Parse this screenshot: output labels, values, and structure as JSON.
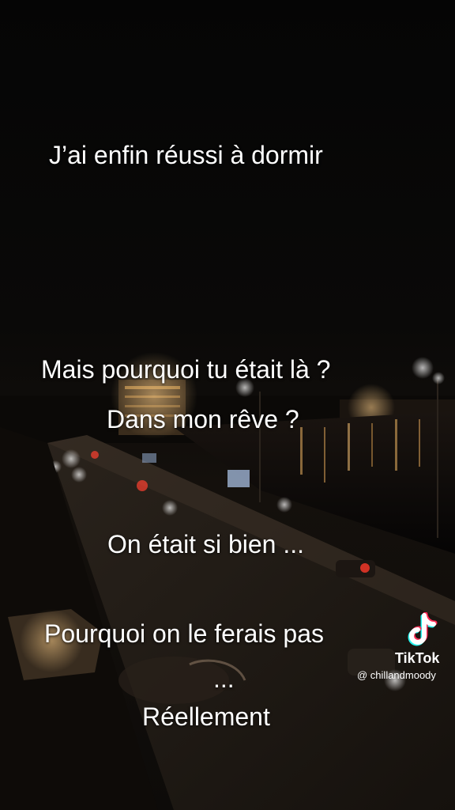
{
  "captions": {
    "line1": "J’ai enfin réussi à dormir",
    "line2": "Mais pourquoi tu était là ?",
    "line3": "Dans mon rêve ?",
    "line4": "On était si bien ...",
    "line5": "Pourquoi on le ferais pas",
    "line6": "...",
    "line7": "Réellement"
  },
  "watermark": {
    "brand": "TikTok",
    "handle": "@ chillandmoody",
    "icon": "tiktok-logo-icon"
  },
  "colors": {
    "text": "#ffffff",
    "background": "#000000",
    "tiktok_cyan": "#25f4ee",
    "tiktok_red": "#fe2c55"
  }
}
